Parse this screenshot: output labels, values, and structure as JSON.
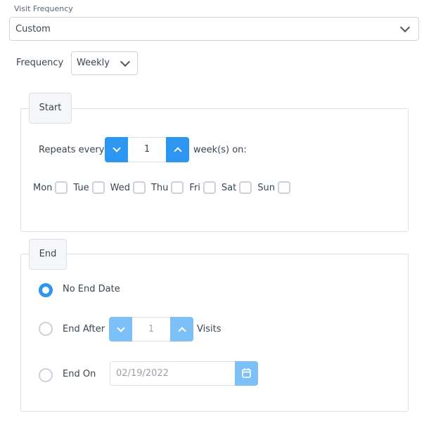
{
  "visit_frequency": {
    "label": "Visit Frequency",
    "value": "Custom"
  },
  "frequency": {
    "label": "Frequency",
    "value": "Weekly"
  },
  "start": {
    "legend": "Start",
    "repeats_label": "Repeats every",
    "repeats_value": "1",
    "repeats_suffix": "week(s) on:",
    "days": [
      {
        "label": "Mon",
        "checked": false
      },
      {
        "label": "Tue",
        "checked": false
      },
      {
        "label": "Wed",
        "checked": false
      },
      {
        "label": "Thu",
        "checked": false
      },
      {
        "label": "Fri",
        "checked": false
      },
      {
        "label": "Sat",
        "checked": false
      },
      {
        "label": "Sun",
        "checked": false
      }
    ]
  },
  "end": {
    "legend": "End",
    "options": [
      {
        "label": "No End Date",
        "selected": true
      },
      {
        "label": "End After",
        "selected": false
      },
      {
        "label": "End On",
        "selected": false
      }
    ],
    "end_after_value": "1",
    "end_after_suffix": "Visits",
    "end_on_date": "02/19/2022"
  },
  "icons": {
    "dropdown": "chevron-down-icon",
    "decrement": "chevron-down-icon",
    "increment": "chevron-up-icon",
    "calendar": "calendar-icon"
  },
  "colors": {
    "accent": "#2c96f0",
    "accent_disabled": "#7dbff7",
    "border": "#dde1e6"
  }
}
